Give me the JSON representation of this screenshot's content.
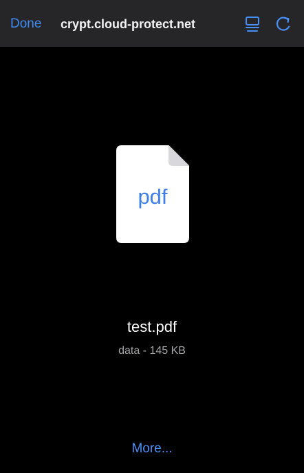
{
  "browser": {
    "done_label": "Done",
    "url": "crypt.cloud-protect.net",
    "icons": {
      "reader": "reader-mode-icon",
      "reload": "reload-icon"
    },
    "colors": {
      "toolbar_background": "#262628",
      "accent": "#3d8bf7"
    }
  },
  "file_preview": {
    "icon_label": "pdf",
    "filename": "test.pdf",
    "details": "data - 145 KB",
    "more_label": "More...",
    "colors": {
      "background": "#000000",
      "document": "#ffffff",
      "pdf_text": "#3f7fe9",
      "secondary_text": "#a7a7aa"
    }
  }
}
